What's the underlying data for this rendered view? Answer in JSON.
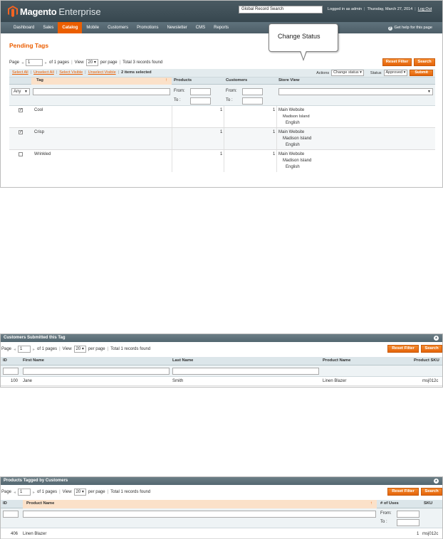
{
  "header": {
    "brand": "Magento",
    "edition": "Enterprise",
    "global_search_placeholder": "Global Record Search",
    "logged_in": "Logged in as admin",
    "date": "Thursday, March 27, 2014",
    "logout": "Log Out"
  },
  "nav": {
    "items": [
      "Dashboard",
      "Sales",
      "Catalog",
      "Mobile",
      "Customers",
      "Promotions",
      "Newsletter",
      "CMS",
      "Reports"
    ],
    "help": "Get help for this page"
  },
  "callout": "Change Status",
  "pending": {
    "title": "Pending Tags",
    "pager": {
      "page_label": "Page",
      "page_value": "1",
      "of_pages": "of 1 pages",
      "view_label": "View",
      "view_value": "20",
      "per_page": "per page",
      "total": "Total 3 records found"
    },
    "reset_filter": "Reset Filter",
    "search": "Search",
    "mass": {
      "select_all": "Select All",
      "unselect_all": "Unselect All",
      "select_visible": "Select Visible",
      "unselect_visible": "Unselect Visible",
      "selected": "2 items selected",
      "actions_label": "Actions",
      "actions_value": "Change status",
      "status_label": "Status",
      "status_value": "Approved",
      "submit": "Submit"
    },
    "columns": {
      "tag": "Tag",
      "products": "Products",
      "customers": "Customers",
      "store_view": "Store View"
    },
    "filter": {
      "any": "Any",
      "from": "From:",
      "to": "To :"
    },
    "rows": [
      {
        "checked": true,
        "tag": "Cool",
        "products": "1",
        "customers": "1",
        "store1": "Main Website",
        "store2": "Madison Island",
        "store3": "English"
      },
      {
        "checked": true,
        "tag": "Crisp",
        "products": "1",
        "customers": "1",
        "store1": "Main Website",
        "store2": "Madison Island",
        "store3": "English"
      },
      {
        "checked": false,
        "tag": "Wrinkled",
        "products": "1",
        "customers": "1",
        "store1": "Main Website",
        "store2": "Madison Island",
        "store3": "English"
      }
    ]
  },
  "customers_panel": {
    "title": "Customers Submitted this Tag",
    "pager": {
      "page_label": "Page",
      "page_value": "1",
      "of_pages": "of 1 pages",
      "view_label": "View",
      "view_value": "20",
      "per_page": "per page",
      "total": "Total 1 records found"
    },
    "reset_filter": "Reset Filter",
    "search": "Search",
    "columns": {
      "id": "ID",
      "first": "First Name",
      "last": "Last Name",
      "product": "Product Name",
      "sku": "Product SKU"
    },
    "row": {
      "id": "100",
      "first": "Jane",
      "last": "Smith",
      "product": "Linen Blazer",
      "sku": "msj012c"
    }
  },
  "products_panel": {
    "title": "Products Tagged by Customers",
    "pager": {
      "page_label": "Page",
      "page_value": "1",
      "of_pages": "of 1 pages",
      "view_label": "View",
      "view_value": "20",
      "per_page": "per page",
      "total": "Total 1 records found"
    },
    "reset_filter": "Reset Filter",
    "search": "Search",
    "columns": {
      "id": "ID",
      "product": "Product Name",
      "uses": "# of Uses",
      "sku": "SKU"
    },
    "filter": {
      "from": "From:",
      "to": "To :"
    },
    "row": {
      "id": "406",
      "product": "Linen Blazer",
      "uses": "1",
      "sku": "msj012c"
    }
  },
  "colors": {
    "accent": "#eb5e00",
    "header": "#37474f",
    "grid_header": "#dce6ea"
  }
}
